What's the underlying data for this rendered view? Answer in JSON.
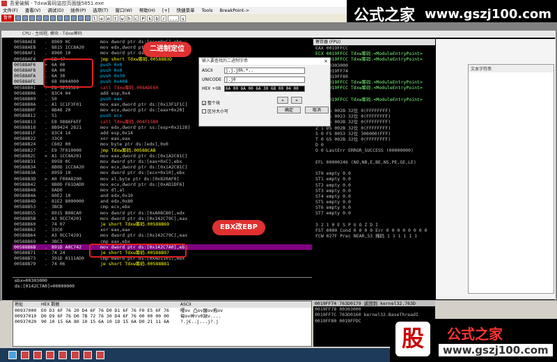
{
  "window": {
    "title": "吾爱破解 - Tdxw筹码监控页面版5851.exe",
    "cpu_title": "CPU - 主线程, 模块 - Tdxw筹码"
  },
  "menu": [
    "文件(F)",
    "查看(V)",
    "调试(D)",
    "插件(P)",
    "选项(T)",
    "窗口(W)",
    "帮助(H)",
    "[+]",
    "快捷菜单",
    "Tools",
    "BreakPoint->"
  ],
  "toolbar": {
    "pause_label": "暂停",
    "letters": [
      "l",
      "e",
      "m",
      "t",
      "w",
      "h",
      "c",
      "P",
      "k",
      "b",
      "r",
      "...",
      "s"
    ]
  },
  "watermark_top": {
    "cn": "公式之家",
    "url": "www.gszj100.com"
  },
  "watermark_bottom": {
    "badge": "股",
    "cn": "公式之家",
    "url": "www.gszj100.com"
  },
  "callouts": {
    "binary_locate": "二进制定位",
    "ebx_to_ebp": "EBX改EBP"
  },
  "disasm": [
    [
      "00588AE8",
      ".",
      "8969 0C",
      "mov dword ptr ds:[ecx+0xC],ebp"
    ],
    [
      "00588AEB",
      ".",
      "8815 1CC8A20",
      "mov edx,dword ptr ds:[0xA2C81C]"
    ],
    [
      "00588AF1",
      ".",
      "8960 10",
      "mov dword ptr ds:[eax+0x10],ebp"
    ],
    [
      "00588AF4",
      ".",
      "EB 47",
      "jmp short Tdxw筹码.00588B3D"
    ],
    [
      "00588AF6",
      ">",
      "6A 00",
      "push 0x0"
    ],
    [
      "00588AF8",
      ".",
      "6A 00",
      "push 0x0"
    ],
    [
      "00588AFA",
      ".",
      "6A 30",
      "push 0x30"
    ],
    [
      "00588AFC",
      ".",
      "68 0804000",
      "push 0x408"
    ],
    [
      "00588B01",
      ".",
      "E8 5E53320",
      "call Tdxw筹码.008ADE60"
    ],
    [
      "00588B06",
      ".",
      "83C4 04",
      "add esp,0x4"
    ],
    [
      "00588B09",
      ".",
      "50",
      "push eax"
    ],
    [
      "00588B0A",
      ".",
      "A1 1C1F3F01",
      "mov eax,dword ptr ds:[0x13F1F1C]"
    ],
    [
      "00588B0F",
      ".",
      "8B48 20",
      "mov ecx,dword ptr ds:[eax+0x20]"
    ],
    [
      "00588B12",
      ".",
      "51",
      "push ecx"
    ],
    [
      "00588B13",
      ".",
      "E8 9886F6FF",
      "call Tdxw筹码.004F15B0"
    ],
    [
      "00588B18",
      ".",
      "8B9424 2821",
      "mov edx,dword ptr ss:[esp+0x2128]"
    ],
    [
      "00588B1F",
      ".",
      "83C4 14",
      "add esp,0x14"
    ],
    [
      "00588B22",
      ".",
      "33C0",
      "xor eax,eax"
    ],
    [
      "00588B24",
      ".",
      "C602 00",
      "mov byte ptr ds:[edx],0x0"
    ],
    [
      "00588B27",
      ".",
      "E9 7F010000",
      "jmp Tdxw筹码.00588CAB"
    ],
    [
      "00588B2C",
      ">",
      "A1 1CC8A201",
      "mov eax,dword ptr ds:[0x1A2C81C]"
    ],
    [
      "00588B31",
      ".",
      "8958 0C",
      "mov dword ptr ds:[eax+0xC],ebx"
    ],
    [
      "00588B34",
      ".",
      "8B0D 1CC8A20",
      "mov ecx,dword ptr ds:[0x1A2C81C]"
    ],
    [
      "00588B3A",
      ".",
      "8959 10",
      "mov dword ptr ds:[ecx+0x10],ebx"
    ],
    [
      "00588B3D",
      ">",
      "A0 F00A8200",
      "mov al,byte ptr ds:[0x820AF0]"
    ],
    [
      "00588B42",
      ".",
      "8B0D F61DAD0",
      "mov ecx,dword ptr ds:[0xAD1DF6]"
    ],
    [
      "00588B48",
      ".",
      "8AD0",
      "mov dl,al"
    ],
    [
      "00588B4A",
      ".",
      "80E2 10",
      "and edx,0x10"
    ],
    [
      "00588B4D",
      ".",
      "81E2 8000000",
      "and edx,0x80"
    ],
    [
      "00588B53",
      ".",
      "3BCB",
      "cmp ecx,ebx"
    ],
    [
      "00588B55",
      ".",
      "8915 B08CA0",
      "mov dword ptr ds:[0xA08CB0],edx"
    ],
    [
      "00588B5B",
      ".",
      "A3 9CC74201",
      "mov dword ptr ds:[0x142C79C],eax"
    ],
    [
      "00588B60",
      ".",
      "74 07",
      "je short Tdxw筹码.00588B69"
    ],
    [
      "00588B62",
      ".",
      "33C0",
      "xor eax,eax"
    ],
    [
      "00588B64",
      ".",
      "A3 9CC74201",
      "mov dword ptr ds:[0x142C79C],eax"
    ],
    [
      "00588B69",
      ">",
      "3BC3",
      "cmp eax,ebx"
    ],
    [
      "00588B6B",
      ".",
      "891D A0C742",
      "mov dword ptr ds:[0x142C7A0],ebx"
    ],
    [
      "00588B71",
      ".",
      "74 24",
      "je short Tdxw筹码.00588B97"
    ],
    [
      "00588B73",
      ".",
      "391D 0111AD0",
      "cmp dword ptr ds:[0xAD1101],ebx"
    ],
    [
      "00588B79",
      ".",
      "74 06",
      "je short Tdxw筹码.00588B81"
    ]
  ],
  "info_lines": [
    "ebx=00303000",
    "ds:[0142C7A0]=00000000"
  ],
  "registers": {
    "header": "寄存器 (FPU)",
    "lines": [
      "EAX 0019FFCC",
      "ECX 0019FFCC Tdxw筹码.<ModuleEntryPoint>",
      "EDX 0019FFCC Tdxw筹码.<ModuleEntryPoint>",
      "EBX 00303000",
      "ESP 0019FF74",
      "EBP 0019FF80",
      "ESI 0019FFCC Tdxw筹码.<ModuleEntryPoint>",
      "EDI 0019FFCC Tdxw筹码.<ModuleEntryPoint>",
      "",
      "EIP 0019FFCC Tdxw筹码.<ModuleEntryPoint>",
      "",
      "C 0  ES 002B 32位 0(FFFFFFFF)",
      "P 1  CS 0023 32位 0(FFFFFFFF)",
      "A 0  SS 002B 32位 0(FFFFFFFF)",
      "Z 1  DS 002B 32位 0(FFFFFFFF)",
      "S 0  FS 0053 32位 306000(FFF)",
      "T 0  GS 002B 32位 0(FFFFFFFF)",
      "D 0",
      "O 0  LastErr ERROR_SUCCESS (00000000)",
      "",
      "EFL 00000246 (NO,NB,E,BE,NS,PE,GE,LE)",
      "",
      "ST0 empty 0.0",
      "ST1 empty 0.0",
      "ST2 empty 0.0",
      "ST3 empty 0.0",
      "ST4 empty 0.0",
      "ST5 empty 0.0",
      "ST6 empty 0.0",
      "ST7 empty 0.0",
      "",
      "               3 2 1 0      E S P U O Z D I",
      "FST 0000  Cond 0 0 0 0  Err 0 0 0 0 0 0 0 0",
      "FCW 027F  Prec NEAR,53  掩码    1 1 1 1 1 1"
    ]
  },
  "right_panel_label": "文本字符串",
  "entry_point_tail": "ntryPoint>",
  "dump": {
    "headers": [
      "地址",
      "HEX 数据",
      "ASCII"
    ],
    "rows": [
      [
        "00937000",
        "E0 D3 6F 76 20 D4 6F 76 D0 D1 6F 76 F0 E5 6F 76",
        "嘤ov 凸ov醒ov疱ov"
      ],
      [
        "00937010",
        "D0 D9 6F 76 D0 7B 72 76 30 D4 6F 76 00 00 00 00",
        "匈ov衶rv0詏v...."
      ],
      [
        "00937020",
        "90 10 15 6A 80 10 15 6A 10 1D 15 6A D0 21 11 6A",
        "?.j€..j...j?.j"
      ]
    ]
  },
  "stack": [
    [
      "0019FF74",
      "763D0179",
      "返回到 kernel32.763D"
    ],
    [
      "0019FF78",
      "00303000",
      ""
    ],
    [
      "0019FF7C",
      "763D0160",
      "kernel32.BaseThreadI"
    ],
    [
      "0019FF80",
      "0019FFDC",
      ""
    ]
  ],
  "dialog": {
    "title": "输入要查找的二进制字串",
    "ascii_label": "ASCII",
    "ascii_value": "j.j.j0h.*..",
    "unicode_label": "UNICODE",
    "unicode_value": "j.j0",
    "hex_label": "HEX +0B",
    "hex_value": "6A 00 6A 00 6A 30 68 00 04 00 00",
    "check_whole": "整个块",
    "check_case": "区分大小写",
    "ok": "确定",
    "cancel": "取消"
  }
}
